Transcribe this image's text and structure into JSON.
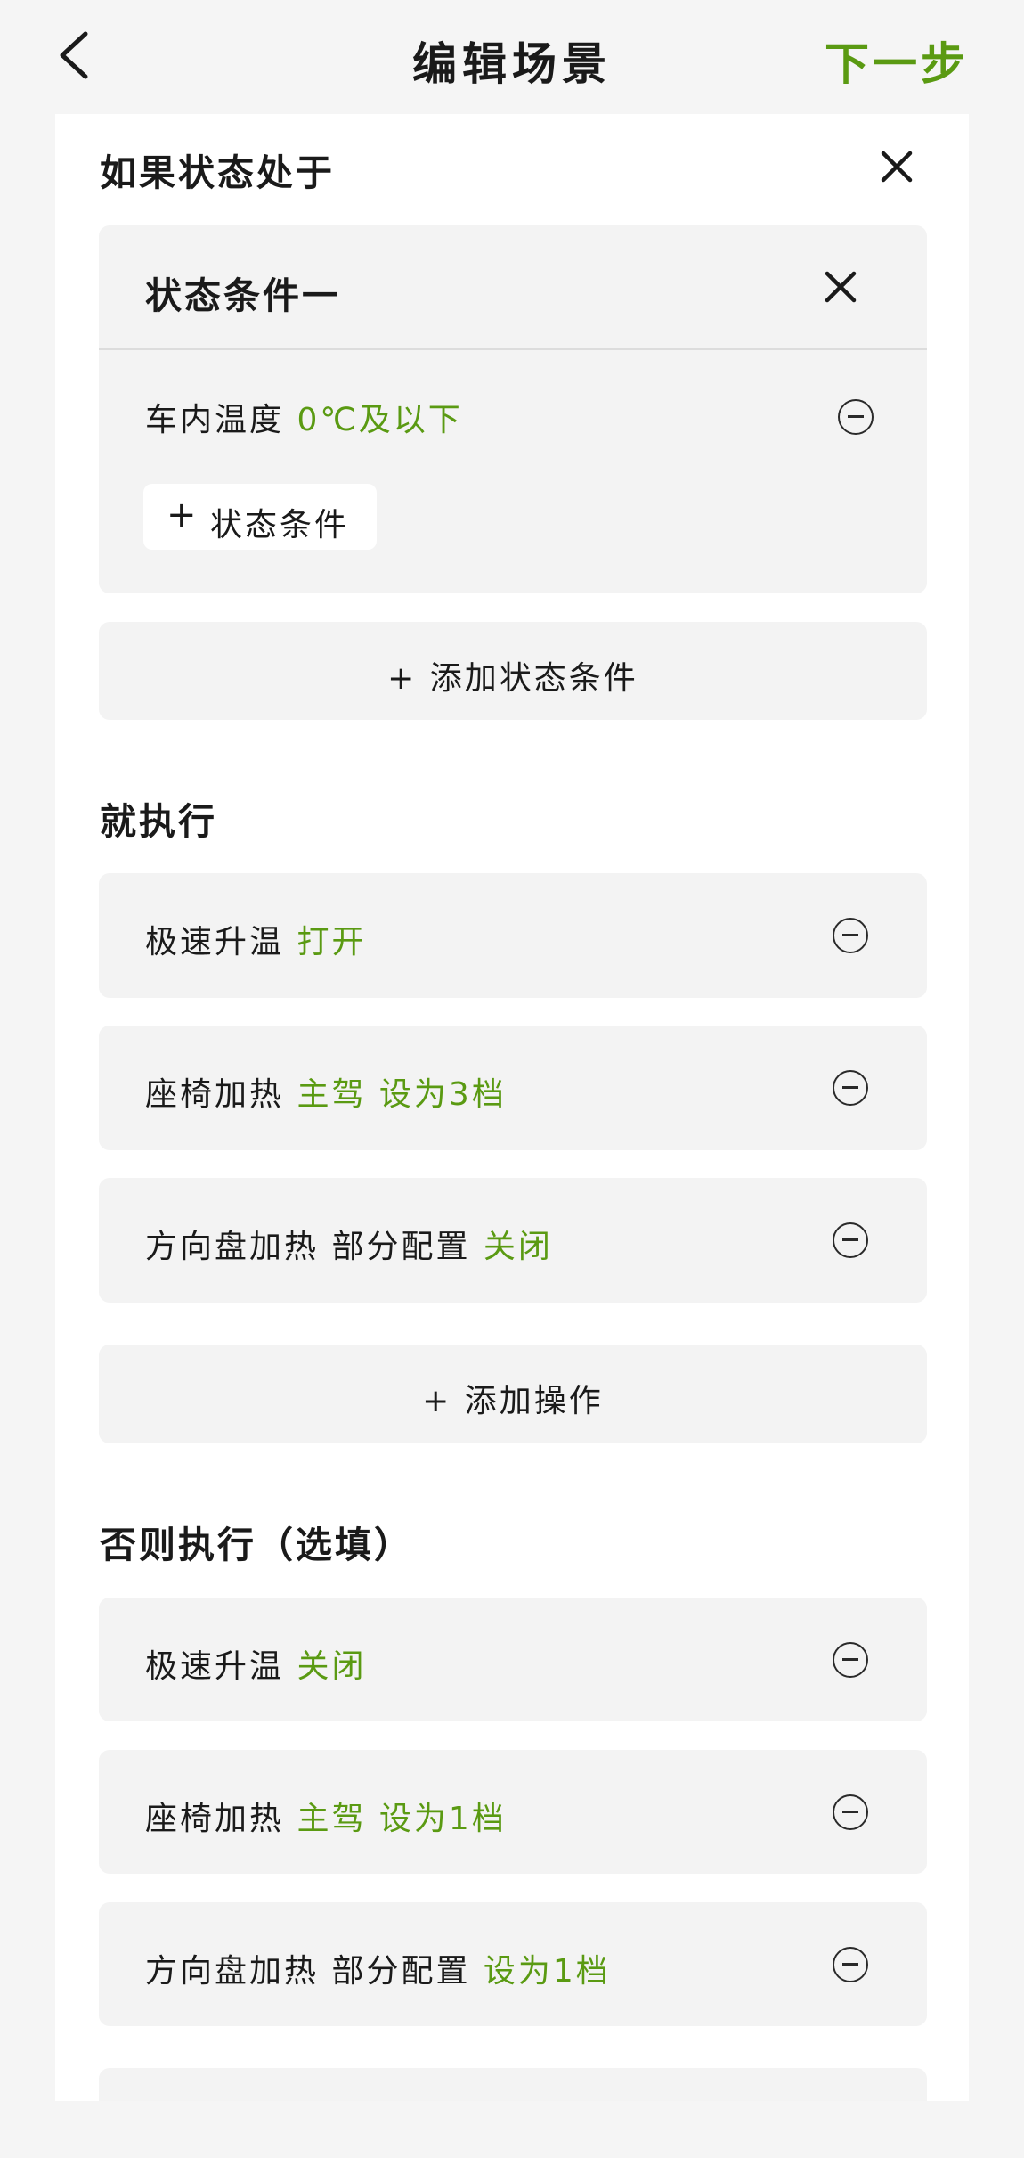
{
  "header": {
    "back_icon": "chevron-left-icon",
    "title": "编辑场景",
    "next_label": "下一步",
    "accent_color": "#5a9a12"
  },
  "condition_section": {
    "heading": "如果状态处于",
    "close_icon": "close-icon",
    "group": {
      "title": "状态条件一",
      "close_icon": "close-icon",
      "rows": [
        {
          "label": "车内温度",
          "value": "0℃及以下"
        }
      ],
      "add_chip": {
        "plus": "+",
        "label": "状态条件"
      }
    },
    "add_condition": {
      "plus": "+",
      "label": "添加状态条件"
    }
  },
  "then_section": {
    "heading": "就执行",
    "rows": [
      {
        "label": "极速升温",
        "value": "打开"
      },
      {
        "label": "座椅加热",
        "value": "主驾 设为3档"
      },
      {
        "label": "方向盘加热 部分配置",
        "value": "关闭"
      }
    ],
    "add_action": {
      "plus": "+",
      "label": "添加操作"
    }
  },
  "else_section": {
    "heading": "否则执行（选填）",
    "rows": [
      {
        "label": "极速升温",
        "value": "关闭"
      },
      {
        "label": "座椅加热",
        "value": "主驾 设为1档"
      },
      {
        "label": "方向盘加热 部分配置",
        "value": "设为1档"
      }
    ]
  }
}
